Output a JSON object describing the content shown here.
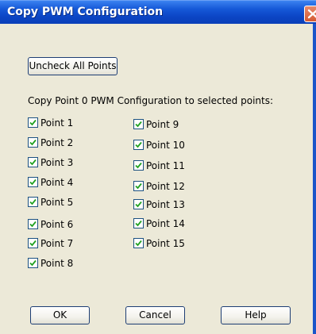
{
  "window": {
    "title": "Copy PWM Configuration",
    "close_icon": "close-icon"
  },
  "uncheck_all_label": "Uncheck All Points",
  "instruction": "Copy Point 0 PWM Configuration to selected points:",
  "points_col1": [
    {
      "label": "Point 1",
      "checked": true
    },
    {
      "label": "Point 2",
      "checked": true
    },
    {
      "label": "Point 3",
      "checked": true
    },
    {
      "label": "Point 4",
      "checked": true
    },
    {
      "label": "Point 5",
      "checked": true
    },
    {
      "label": "Point 6",
      "checked": true
    },
    {
      "label": "Point 7",
      "checked": true
    },
    {
      "label": "Point 8",
      "checked": true
    }
  ],
  "points_col2": [
    {
      "label": "Point 9",
      "checked": true
    },
    {
      "label": "Point 10",
      "checked": true
    },
    {
      "label": "Point 11",
      "checked": true
    },
    {
      "label": "Point 12",
      "checked": true
    },
    {
      "label": "Point 13",
      "checked": true
    },
    {
      "label": "Point 14",
      "checked": true
    },
    {
      "label": "Point 15",
      "checked": true
    }
  ],
  "buttons": {
    "ok": "OK",
    "cancel": "Cancel",
    "help": "Help"
  },
  "colors": {
    "titlebar": "#0b45c4",
    "dialog_bg": "#ece9d8",
    "checkmark": "#21a121"
  }
}
